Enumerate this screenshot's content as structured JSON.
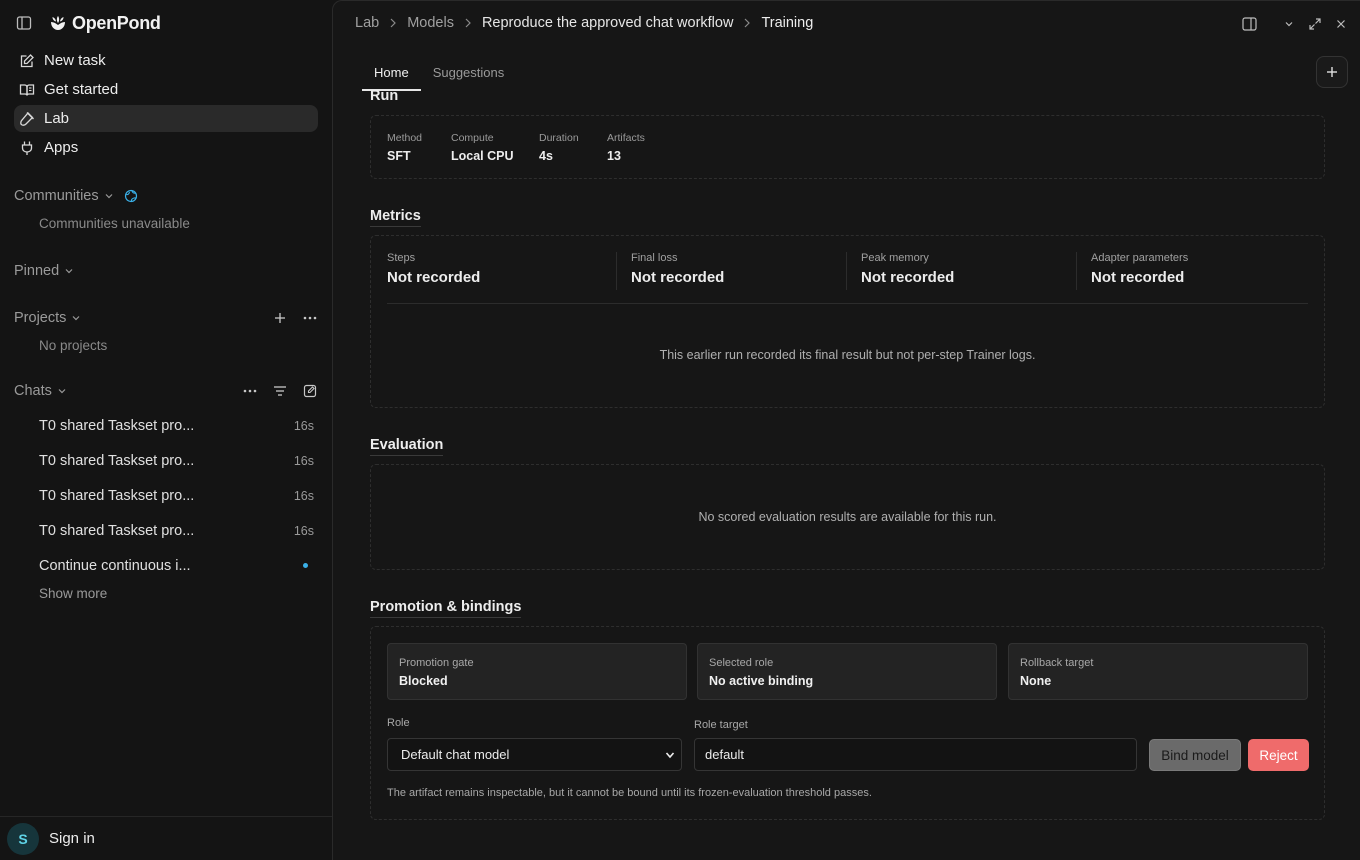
{
  "brand": {
    "name": "OpenPond"
  },
  "nav": [
    {
      "label": "New task",
      "icon": "edit-icon"
    },
    {
      "label": "Get started",
      "icon": "book-icon"
    },
    {
      "label": "Lab",
      "icon": "flask-icon"
    },
    {
      "label": "Apps",
      "icon": "plug-icon"
    }
  ],
  "communities": {
    "label": "Communities",
    "empty": "Communities unavailable"
  },
  "pinned": {
    "label": "Pinned"
  },
  "projects": {
    "label": "Projects",
    "empty": "No projects"
  },
  "chats": {
    "label": "Chats",
    "items": [
      {
        "title": "T0 shared Taskset pro...",
        "age": "16s"
      },
      {
        "title": "T0 shared Taskset pro...",
        "age": "16s"
      },
      {
        "title": "T0 shared Taskset pro...",
        "age": "16s"
      },
      {
        "title": "T0 shared Taskset pro...",
        "age": "16s"
      },
      {
        "title": "Continue continuous i...",
        "age": ""
      }
    ],
    "show_more": "Show more"
  },
  "user": {
    "initial": "S",
    "signin": "Sign in"
  },
  "breadcrumb": [
    "Lab",
    "Models",
    "Reproduce the approved chat workflow",
    "Training"
  ],
  "tabs": [
    "Home",
    "Suggestions"
  ],
  "run": {
    "title": "Run",
    "fields": [
      {
        "key": "Method",
        "value": "SFT"
      },
      {
        "key": "Compute",
        "value": "Local CPU"
      },
      {
        "key": "Duration",
        "value": "4s"
      },
      {
        "key": "Artifacts",
        "value": "13"
      }
    ]
  },
  "metrics": {
    "title": "Metrics",
    "items": [
      {
        "key": "Steps",
        "value": "Not recorded"
      },
      {
        "key": "Final loss",
        "value": "Not recorded"
      },
      {
        "key": "Peak memory",
        "value": "Not recorded"
      },
      {
        "key": "Adapter parameters",
        "value": "Not recorded"
      }
    ],
    "note": "This earlier run recorded its final result but not per-step Trainer logs."
  },
  "evaluation": {
    "title": "Evaluation",
    "note": "No scored evaluation results are available for this run."
  },
  "promotion": {
    "title": "Promotion & bindings",
    "boxes": [
      {
        "key": "Promotion gate",
        "value": "Blocked"
      },
      {
        "key": "Selected role",
        "value": "No active binding"
      },
      {
        "key": "Rollback target",
        "value": "None"
      }
    ],
    "role_label": "Role",
    "role_value": "Default chat model",
    "role_target_label": "Role target",
    "role_target_value": "default",
    "bind_label": "Bind model",
    "reject_label": "Reject",
    "footnote": "The artifact remains inspectable, but it cannot be bound until its frozen-evaluation threshold passes."
  }
}
